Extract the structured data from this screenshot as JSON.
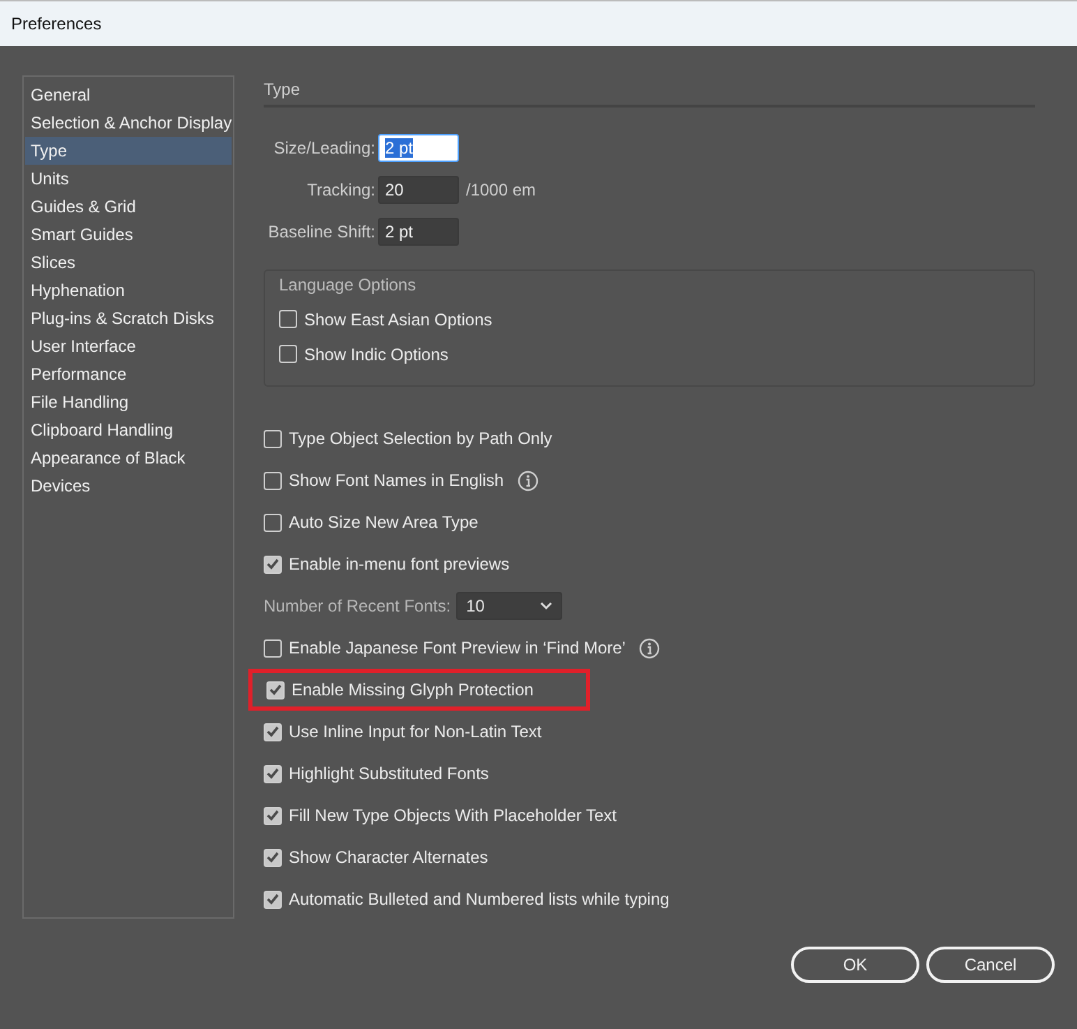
{
  "window": {
    "title": "Preferences"
  },
  "sidebar": {
    "items": [
      {
        "label": "General",
        "selected": false
      },
      {
        "label": "Selection & Anchor Display",
        "selected": false
      },
      {
        "label": "Type",
        "selected": true
      },
      {
        "label": "Units",
        "selected": false
      },
      {
        "label": "Guides & Grid",
        "selected": false
      },
      {
        "label": "Smart Guides",
        "selected": false
      },
      {
        "label": "Slices",
        "selected": false
      },
      {
        "label": "Hyphenation",
        "selected": false
      },
      {
        "label": "Plug-ins & Scratch Disks",
        "selected": false
      },
      {
        "label": "User Interface",
        "selected": false
      },
      {
        "label": "Performance",
        "selected": false
      },
      {
        "label": "File Handling",
        "selected": false
      },
      {
        "label": "Clipboard Handling",
        "selected": false
      },
      {
        "label": "Appearance of Black",
        "selected": false
      },
      {
        "label": "Devices",
        "selected": false
      }
    ]
  },
  "section_title": "Type",
  "fields": [
    {
      "label": "Size/Leading:",
      "value": "2 pt",
      "selected": true
    },
    {
      "label": "Tracking:",
      "value": "20",
      "unit": "/1000 em",
      "selected": false
    },
    {
      "label": "Baseline Shift:",
      "value": "2 pt",
      "selected": false
    }
  ],
  "language_options": {
    "title": "Language Options",
    "items": [
      {
        "label": "Show East Asian Options",
        "checked": false
      },
      {
        "label": "Show Indic Options",
        "checked": false
      }
    ]
  },
  "options": [
    {
      "kind": "checkbox",
      "label": "Type Object Selection by Path Only",
      "checked": false,
      "info": false,
      "highlighted": false
    },
    {
      "kind": "checkbox",
      "label": "Show Font Names in English",
      "checked": false,
      "info": true,
      "highlighted": false
    },
    {
      "kind": "checkbox",
      "label": "Auto Size New Area Type",
      "checked": false,
      "info": false,
      "highlighted": false
    },
    {
      "kind": "checkbox",
      "label": "Enable in-menu font previews",
      "checked": true,
      "info": false,
      "highlighted": false
    },
    {
      "kind": "dropdown",
      "label": "Number of Recent Fonts:",
      "value": "10"
    },
    {
      "kind": "checkbox",
      "label": "Enable Japanese Font Preview in ‘Find More’",
      "checked": false,
      "info": true,
      "highlighted": false
    },
    {
      "kind": "checkbox",
      "label": "Enable Missing Glyph Protection",
      "checked": true,
      "info": false,
      "highlighted": true
    },
    {
      "kind": "checkbox",
      "label": "Use Inline Input for Non-Latin Text",
      "checked": true,
      "info": false,
      "highlighted": false
    },
    {
      "kind": "checkbox",
      "label": "Highlight Substituted Fonts",
      "checked": true,
      "info": false,
      "highlighted": false
    },
    {
      "kind": "checkbox",
      "label": "Fill New Type Objects With Placeholder Text",
      "checked": true,
      "info": false,
      "highlighted": false
    },
    {
      "kind": "checkbox",
      "label": "Show Character Alternates",
      "checked": true,
      "info": false,
      "highlighted": false
    },
    {
      "kind": "checkbox",
      "label": "Automatic Bulleted and Numbered lists while typing",
      "checked": true,
      "info": false,
      "highlighted": false
    }
  ],
  "buttons": [
    {
      "label": "OK"
    },
    {
      "label": "Cancel"
    }
  ]
}
